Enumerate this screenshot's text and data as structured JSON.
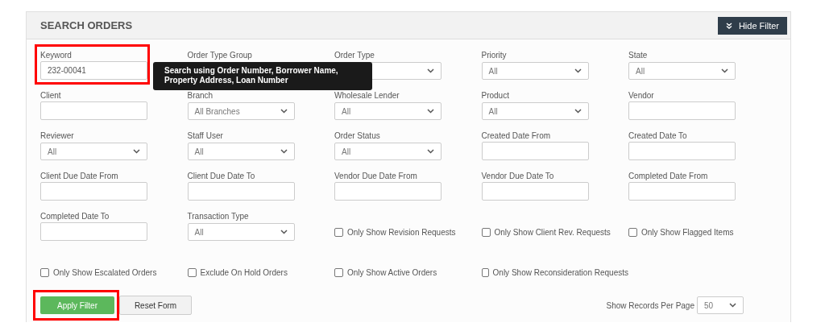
{
  "panel": {
    "title": "SEARCH ORDERS",
    "toggle_button": "Hide Filter"
  },
  "filters": {
    "tooltip": "Search using Order Number, Borrower Name, Property Address, Loan Number",
    "rows": [
      [
        {
          "kind": "text",
          "label": "Keyword",
          "value": "232-00041",
          "highlighted": true
        },
        {
          "kind": "label",
          "label": "Order Type Group"
        },
        {
          "kind": "select",
          "label": "Order Type"
        },
        {
          "kind": "select",
          "label": "Priority",
          "value": "All"
        },
        {
          "kind": "select",
          "label": "State",
          "value": "All"
        }
      ],
      [
        {
          "kind": "text",
          "label": "Client"
        },
        {
          "kind": "select",
          "label": "Branch",
          "value": "All Branches"
        },
        {
          "kind": "select",
          "label": "Wholesale Lender",
          "value": "All"
        },
        {
          "kind": "select",
          "label": "Product",
          "value": "All"
        },
        {
          "kind": "text",
          "label": "Vendor"
        }
      ],
      [
        {
          "kind": "select",
          "label": "Reviewer",
          "value": "All"
        },
        {
          "kind": "select",
          "label": "Staff User",
          "value": "All"
        },
        {
          "kind": "select",
          "label": "Order Status",
          "value": "All"
        },
        {
          "kind": "text",
          "label": "Created Date From"
        },
        {
          "kind": "text",
          "label": "Created Date To"
        }
      ],
      [
        {
          "kind": "text",
          "label": "Client Due Date From"
        },
        {
          "kind": "text",
          "label": "Client Due Date To"
        },
        {
          "kind": "text",
          "label": "Vendor Due Date From"
        },
        {
          "kind": "text",
          "label": "Vendor Due Date To"
        },
        {
          "kind": "text",
          "label": "Completed Date From"
        }
      ],
      [
        {
          "kind": "text",
          "label": "Completed Date To"
        },
        {
          "kind": "select",
          "label": "Transaction Type",
          "value": "All"
        },
        {
          "kind": "checkbox",
          "label": "Only Show Revision Requests",
          "checked": false
        },
        {
          "kind": "checkbox",
          "label": "Only Show Client Rev. Requests",
          "checked": false
        },
        {
          "kind": "checkbox",
          "label": "Only Show Flagged Items",
          "checked": false
        }
      ],
      [
        {
          "kind": "checkbox",
          "label": "Only Show Escalated Orders",
          "checked": false
        },
        {
          "kind": "checkbox",
          "label": "Exclude On Hold Orders",
          "checked": false
        },
        {
          "kind": "checkbox",
          "label": "Only Show Active Orders",
          "checked": false
        },
        {
          "kind": "checkbox",
          "label": "Only Show Reconsideration Requests",
          "checked": false
        }
      ]
    ]
  },
  "actions": {
    "apply": {
      "label": "Apply Filter",
      "highlighted": true
    },
    "reset": {
      "label": "Reset Form"
    }
  },
  "page_size": {
    "label": "Show Records Per Page",
    "value": "50"
  }
}
